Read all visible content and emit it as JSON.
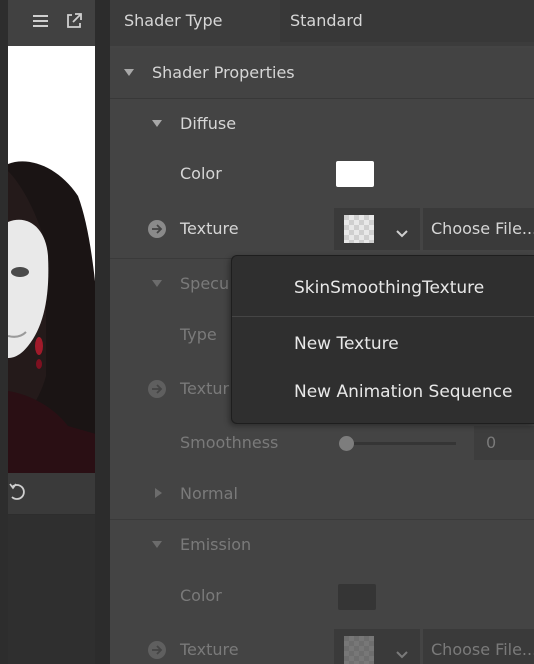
{
  "inspector": {
    "shader_type": {
      "label": "Shader Type",
      "value": "Standard"
    },
    "shader_properties": {
      "label": "Shader Properties"
    },
    "diffuse": {
      "label": "Diffuse",
      "color_label": "Color",
      "color_value": "#ffffff",
      "texture_label": "Texture",
      "choose_file": "Choose File..."
    },
    "specular": {
      "label": "Specu",
      "type_label": "Type",
      "texture_label": "Textur",
      "smoothness_label": "Smoothness",
      "smoothness_value": "0"
    },
    "normal": {
      "label": "Normal"
    },
    "emission": {
      "label": "Emission",
      "color_label": "Color",
      "color_value": "#353535",
      "texture_label": "Texture",
      "choose_file": "Choose File..."
    }
  },
  "dropdown": {
    "items": [
      {
        "label": "SkinSmoothingTexture"
      },
      {
        "label": "New Texture"
      },
      {
        "label": "New Animation Sequence"
      }
    ]
  },
  "viewport": {
    "icons": [
      "menu-icon",
      "popout-icon",
      "reset-icon"
    ]
  },
  "colors": {
    "panel_bg": "#444444",
    "field_bg": "#3a3a3a",
    "menu_bg": "#2f2f2f"
  }
}
